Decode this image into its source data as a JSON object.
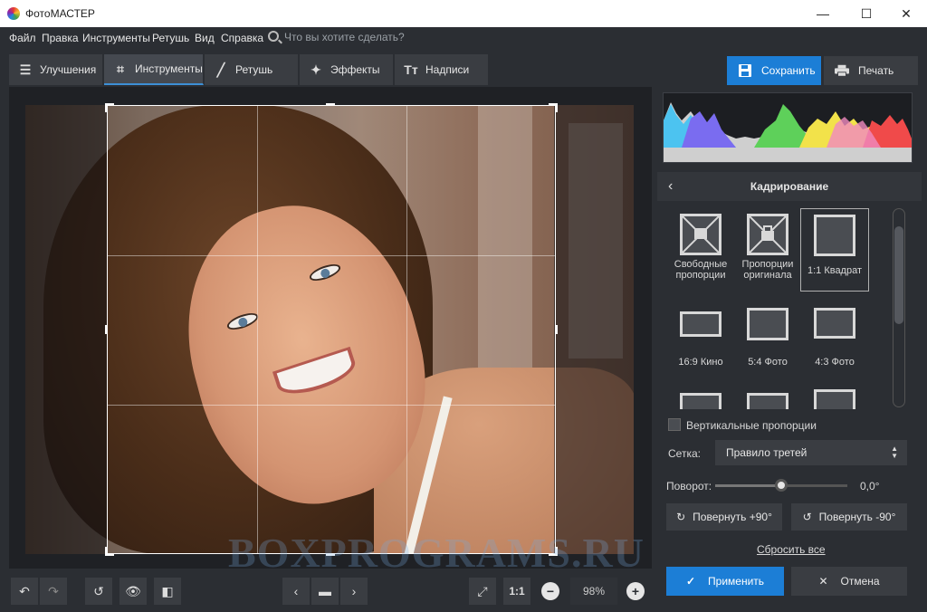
{
  "window": {
    "title": "ФотоМАСТЕР",
    "minimize": "—",
    "maximize": "☐",
    "close": "✕"
  },
  "menu": {
    "items": [
      "Файл",
      "Правка",
      "Инструменты",
      "Ретушь",
      "Вид",
      "Справка"
    ],
    "search_placeholder": "Что вы хотите сделать?"
  },
  "tabs": [
    {
      "label": "Улучшения",
      "icon": "sliders-icon"
    },
    {
      "label": "Инструменты",
      "icon": "crop-icon",
      "active": true
    },
    {
      "label": "Ретушь",
      "icon": "brush-icon"
    },
    {
      "label": "Эффекты",
      "icon": "magic-wand-icon"
    },
    {
      "label": "Надписи",
      "icon": "text-icon"
    }
  ],
  "actions": {
    "save": "Сохранить",
    "print": "Печать"
  },
  "panel": {
    "section_title": "Кадрирование",
    "presets": [
      {
        "label": "Свободные пропорции"
      },
      {
        "label": "Пропорции оригинала"
      },
      {
        "label": "1:1 Квадрат",
        "selected": true
      },
      {
        "label": "16:9 Кино"
      },
      {
        "label": "5:4 Фото"
      },
      {
        "label": "4:3 Фото"
      }
    ],
    "vertical_label": "Вертикальные пропорции",
    "grid_label": "Сетка:",
    "grid_value": "Правило третей",
    "rotation_label": "Поворот:",
    "rotation_value": "0,0°",
    "rotation_level": 0.5,
    "rotate_plus": "Повернуть +90°",
    "rotate_minus": "Повернуть -90°",
    "reset": "Сбросить все",
    "apply": "Применить",
    "cancel": "Отмена"
  },
  "bottom": {
    "ratio": "1:1",
    "zoom": "98%"
  },
  "watermark": "BOXPROGRAMS.RU",
  "colors": {
    "accent": "#1c7ed6",
    "bg": "#2b2e33",
    "panel": "#3a3d42"
  }
}
